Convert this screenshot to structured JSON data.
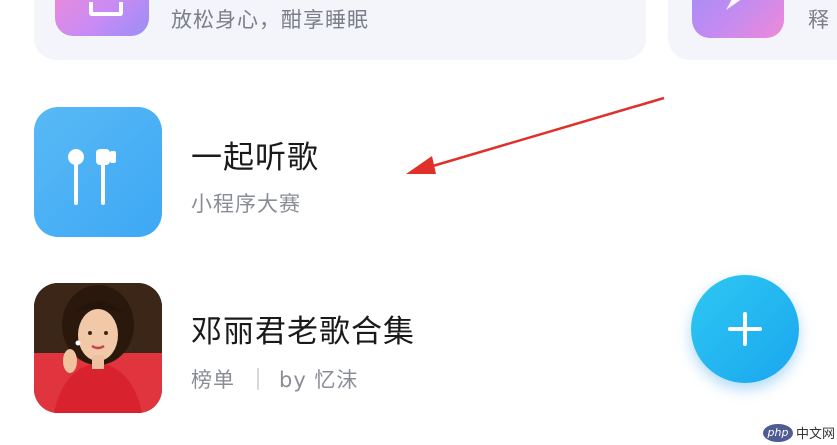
{
  "top_cards": [
    {
      "subtitle": "放松身心，酣享睡眠"
    },
    {
      "subtitle": "释"
    }
  ],
  "playlist_items": [
    {
      "title": "一起听歌",
      "subtitle": "小程序大赛"
    },
    {
      "title": "邓丽君老歌合集",
      "category": "榜单",
      "author": "by 忆沫"
    }
  ],
  "fab": {
    "icon": "plus-icon",
    "color": "#1ba8ef"
  },
  "annotation": {
    "type": "arrow",
    "color": "#e0302a"
  },
  "watermark": {
    "logo": "php",
    "text": "中文网"
  },
  "colors": {
    "music_icon_bg": "#4eb3f5",
    "top_left_icon_gradient": [
      "#f08ad4",
      "#9b8cf6"
    ],
    "top_right_icon_gradient": [
      "#a58cf6",
      "#ef8ad8"
    ],
    "subtitle_gray": "#8a8d96"
  }
}
